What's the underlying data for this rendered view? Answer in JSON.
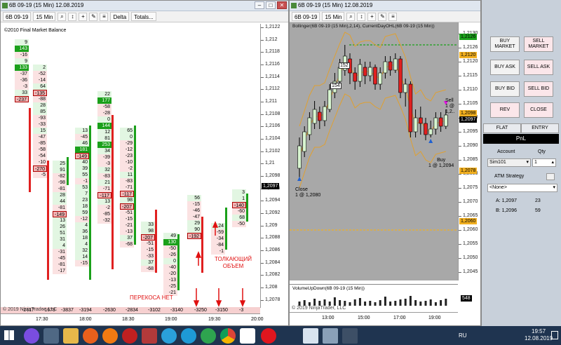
{
  "left_window": {
    "title": "6B 09-19 (15 Min)  12.08.2019",
    "toolbar": {
      "instrument": "6B 09-19",
      "interval": "15 Min",
      "indicator": "Delta",
      "menu": "Totals..."
    },
    "copyright": "©2010 Final Market Balance",
    "footer_copyright": "© 2019 NinjaTrader, LLC",
    "price_axis": [
      "1,2122",
      "1,212",
      "1,2118",
      "1,2116",
      "1,2114",
      "1,2112",
      "1,211",
      "1,2108",
      "1,2106",
      "1,2104",
      "1,2102",
      "1,21",
      "1,2098",
      "1,2096",
      "1,2094",
      "1,2092",
      "1,209",
      "1,2088",
      "1,2086",
      "1,2084",
      "1,2082",
      "1,208",
      "1,2078"
    ],
    "current_price": "1,2097",
    "time_axis": [
      "17:30",
      "18:00",
      "18:30",
      "19:00",
      "19:30",
      "20:00"
    ],
    "delta_totals": [
      "-2417",
      "-1678",
      "-3837",
      "-3194",
      "-2630",
      "-2834",
      "-3102",
      "-3140",
      "-3250",
      "-3150",
      "-3"
    ],
    "annotations": {
      "pushing_volume_1": "ТОЛКАЮЩИЙ",
      "pushing_volume_2": "ОБЪЕМ",
      "no_imbalance": "ПЕРЕКОСА НЕТ"
    },
    "columns": [
      {
        "values": [
          "9",
          "143",
          "-16",
          "9",
          "133",
          "-37",
          "-36",
          "-3",
          "33",
          "-237"
        ]
      },
      {
        "values": [
          "2",
          "-52",
          "-14",
          "64",
          "-135",
          "-88",
          "28",
          "85",
          "-93",
          "-33",
          "15",
          "-47",
          "-85",
          "-58",
          "-54",
          "-10",
          "-270",
          "-5"
        ]
      },
      {
        "values": [
          "25",
          "91",
          "-82",
          "-98",
          "-81",
          "28",
          "44",
          "-81",
          "-149",
          "13",
          "26",
          "51",
          "31",
          "4",
          "-31",
          "-45",
          "-81",
          "-17"
        ]
      },
      {
        "values": [
          "13",
          "-45",
          "46",
          "181",
          "-149",
          "40",
          "39",
          "55",
          "-1",
          "53",
          "7",
          "23",
          "18",
          "59",
          "-12",
          "4",
          "36",
          "18",
          "4",
          "32",
          "14",
          "-15"
        ]
      },
      {
        "values": [
          "22",
          "177",
          "-58",
          "-28",
          "0",
          "144",
          "12",
          "81",
          "253",
          "34",
          "-39",
          "-3",
          "32",
          "-83",
          "21",
          "-71",
          "-117",
          "13",
          "-2",
          "-85",
          "-32"
        ]
      },
      {
        "values": [
          "65",
          "0",
          "-29",
          "-12",
          "-23",
          "-10",
          "-2",
          "11",
          "-83",
          "-71",
          "-117",
          "98",
          "-207",
          "-51",
          "-15",
          "-21",
          "-13",
          "37",
          "-68"
        ]
      },
      {
        "values": [
          "33",
          "98",
          "-207",
          "-51",
          "-15",
          "-33",
          "37",
          "-68"
        ]
      },
      {
        "values": [
          "49",
          "130",
          "-50",
          "-26",
          "0",
          "-40",
          "-20",
          "-13",
          "-25",
          "-21"
        ]
      },
      {
        "values": [
          "56",
          "-15",
          "-46",
          "-47",
          "29",
          "90",
          "-192"
        ]
      },
      {
        "values": [
          "24",
          "-59",
          "-34",
          "-84",
          "-1"
        ]
      },
      {
        "values": [
          "3",
          "1",
          "-140",
          "-60",
          "68",
          "-50"
        ]
      }
    ]
  },
  "right_window": {
    "title": "6B 09-19 (15 Min)  12.08.2019",
    "toolbar": {
      "instrument": "6B 09-19",
      "interval": "15 Min"
    },
    "indicator_label": "Bollinger(6B 09-19 (15 Min),2,14), CurrentDayOHL(6B 09-19 (15 Min))",
    "price_axis": [
      "1,2130",
      "1,2126",
      "1,2120",
      "1,2115",
      "1,2110",
      "1,2105",
      "1,2100",
      "1,2095",
      "1,2090",
      "1,2085",
      "1,2080",
      "1,2075",
      "1,2070",
      "1,2065",
      "1,2060",
      "1,2055",
      "1,2050",
      "1,2045"
    ],
    "tags": {
      "high": "1,2126",
      "mid": "1,2120",
      "current": "1,2097",
      "current2": "1,2098",
      "low": "1,2078",
      "low2": "1,2060"
    },
    "volume_label": "VolumeUpDown(6B 09-19 (15 Min))",
    "volume_tag": "548",
    "copyright": "© 2019 NinjaTrader, LLC",
    "time_axis": [
      "13:00",
      "15:00",
      "17:00",
      "19:00"
    ],
    "trade_labels": {
      "close": "Close",
      "close_price": "1 @ 1,2080",
      "buy": "Buy",
      "buy_price": "1 @ 1,2094",
      "sell": "Sell",
      "sell_price": "1 @ 1,2..",
      "label_152": "152",
      "label_154": "154"
    }
  },
  "order_panel": {
    "buy_market": "BUY MARKET",
    "sell_market": "SELL MARKET",
    "buy_ask": "BUY ASK",
    "sell_ask": "SELL ASK",
    "buy_bid": "BUY BID",
    "sell_bid": "SELL BID",
    "rev": "REV",
    "close": "CLOSE",
    "flat": "FLAT",
    "entry": "ENTRY",
    "pnl": "PnL",
    "account_label": "Account",
    "qty_label": "Qty",
    "account_value": "Sim101",
    "qty_value": "1",
    "atm_label": "ATM Strategy",
    "atm_value": "<None>",
    "ask_label": "A:",
    "ask_price": "1,2097",
    "ask_size": "23",
    "bid_label": "B:",
    "bid_price": "1,2096",
    "bid_size": "59"
  },
  "taskbar": {
    "lang": "RU",
    "time": "19:57",
    "date": "12.08.2019"
  },
  "colors": {
    "bull": "#1aa01a",
    "bear": "#e02020",
    "panel": "#c8d0da",
    "taskbar": "#1f3450"
  }
}
